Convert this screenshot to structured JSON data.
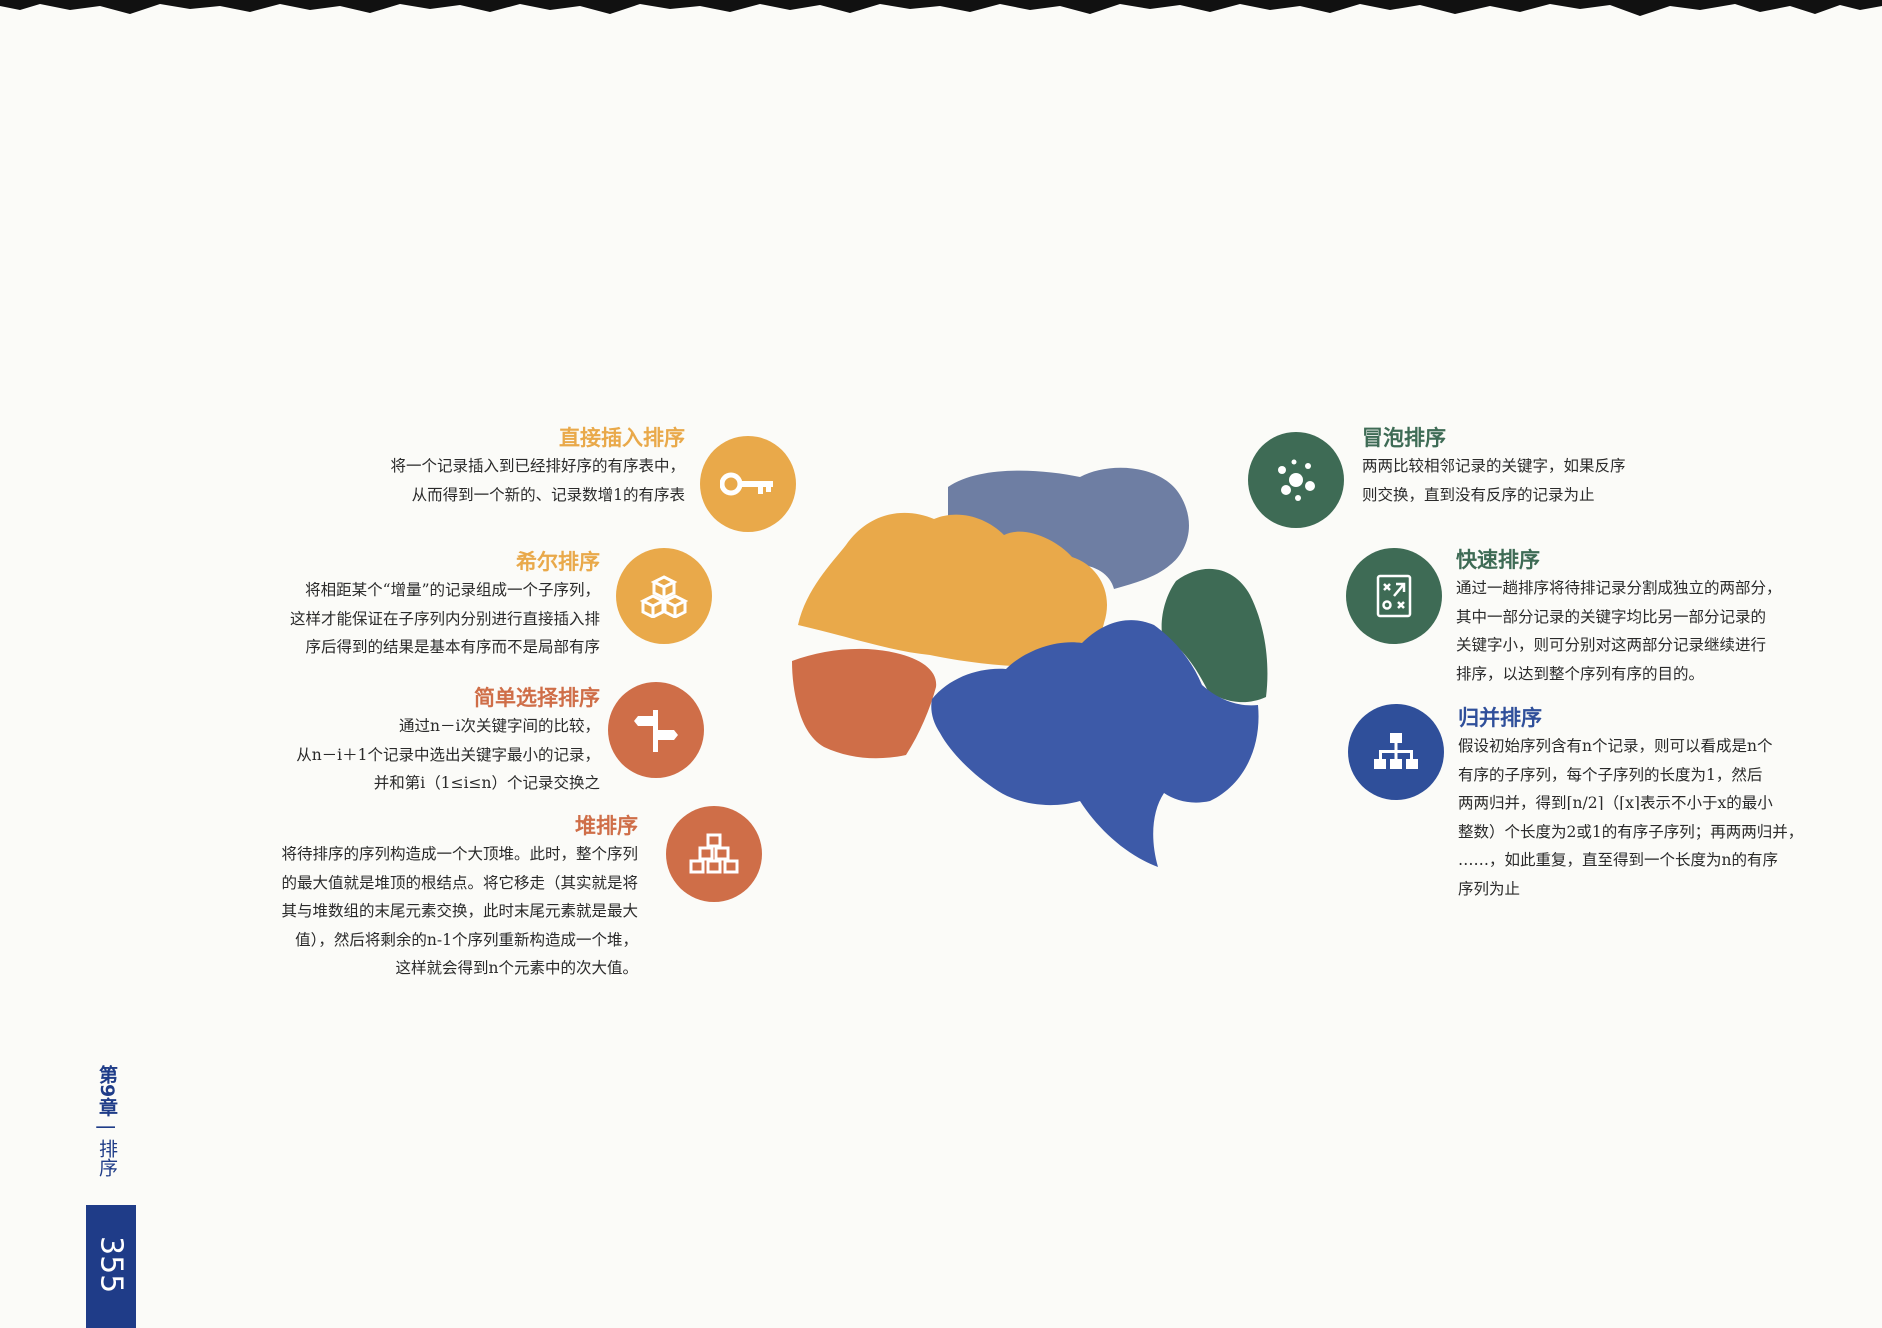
{
  "topics_left": [
    {
      "key": "insertion",
      "title": "直接插入排序",
      "desc": "将一个记录插入到已经排好序的有序表中，\n从而得到一个新的、记录数增1的有序表",
      "color": "#e9a94a",
      "icon": "key-icon"
    },
    {
      "key": "shell",
      "title": "希尔排序",
      "desc": "将相距某个“增量”的记录组成一个子序列，\n这样才能保证在子序列内分别进行直接插入排\n序后得到的结果是基本有序而不是局部有序",
      "color": "#e9a94a",
      "icon": "cubes-icon"
    },
    {
      "key": "selection",
      "title": "简单选择排序",
      "desc": "通过n－i次关键字间的比较，\n从n－i＋1个记录中选出关键字最小的记录，\n并和第i（1≤i≤n）个记录交换之",
      "color": "#cf6e48",
      "icon": "signpost-icon"
    },
    {
      "key": "heap",
      "title": "堆排序",
      "desc": "将待排序的序列构造成一个大顶堆。此时，整个序列\n的最大值就是堆顶的根结点。将它移走（其实就是将\n其与堆数组的末尾元素交换，此时末尾元素就是最大\n值），然后将剩余的n-1个序列重新构造成一个堆，\n这样就会得到n个元素中的次大值。",
      "color": "#cf6e48",
      "icon": "boxes-pyramid-icon"
    }
  ],
  "topics_right": [
    {
      "key": "bubble",
      "title": "冒泡排序",
      "desc": "两两比较相邻记录的关键字，如果反序\n则交换，直到没有反序的记录为止",
      "color": "#3e6b55",
      "icon": "bubbles-icon"
    },
    {
      "key": "quick",
      "title": "快速排序",
      "desc": "通过一趟排序将待排记录分割成独立的两部分，\n其中一部分记录的关键字均比另一部分记录的\n关键字小，则可分别对这两部分记录继续进行\n排序，以达到整个序列有序的目的。",
      "color": "#3e6b55",
      "icon": "strategy-board-icon"
    },
    {
      "key": "merge",
      "title": "归并排序",
      "desc": "假设初始序列含有n个记录，则可以看成是n个\n有序的子序列，每个子序列的长度为1，然后\n两两归并，得到⌈n/2⌉（⌈x⌉表示不小于x的最小\n整数）个长度为2或1的有序子序列；再两两归并，\n……，如此重复，直至得到一个长度为n的有序\n序列为止",
      "color": "#2f4f9a",
      "icon": "hierarchy-icon"
    }
  ],
  "brain_colors": {
    "orange": "#e9a94a",
    "slate": "#6e7ea3",
    "green": "#3e6b55",
    "blue": "#3d5aa8",
    "red": "#cf6e48"
  },
  "footer": {
    "chapter": "第9章",
    "separator": "|",
    "section": "排序",
    "page_number": "355"
  }
}
